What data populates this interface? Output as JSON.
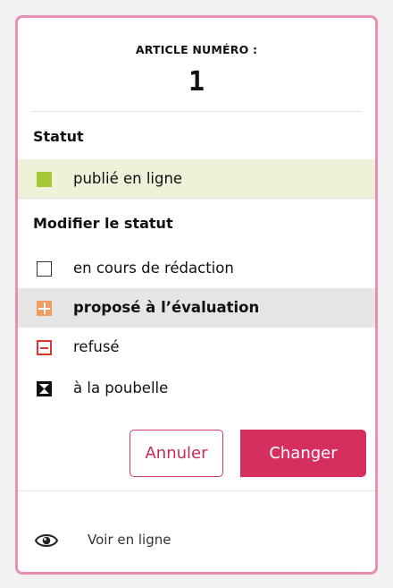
{
  "header": {
    "label": "ARTICLE NUMÉRO :",
    "number": "1"
  },
  "status": {
    "title": "Statut",
    "current": "publié en ligne",
    "current_color": "#a4c637"
  },
  "modify": {
    "title": "Modifier le statut",
    "options": [
      {
        "label": "en cours de rédaction",
        "icon": "empty-square-icon",
        "selected": false
      },
      {
        "label": "proposé à l’évaluation",
        "icon": "orange-grid-icon",
        "selected": true
      },
      {
        "label": "refusé",
        "icon": "red-minus-square-icon",
        "selected": false
      },
      {
        "label": "à la poubelle",
        "icon": "trash-hourglass-icon",
        "selected": false
      }
    ]
  },
  "actions": {
    "cancel": "Annuler",
    "change": "Changer",
    "accent": "#d52f60"
  },
  "footer": {
    "view_label": "Voir en ligne",
    "icon": "eye-icon"
  }
}
